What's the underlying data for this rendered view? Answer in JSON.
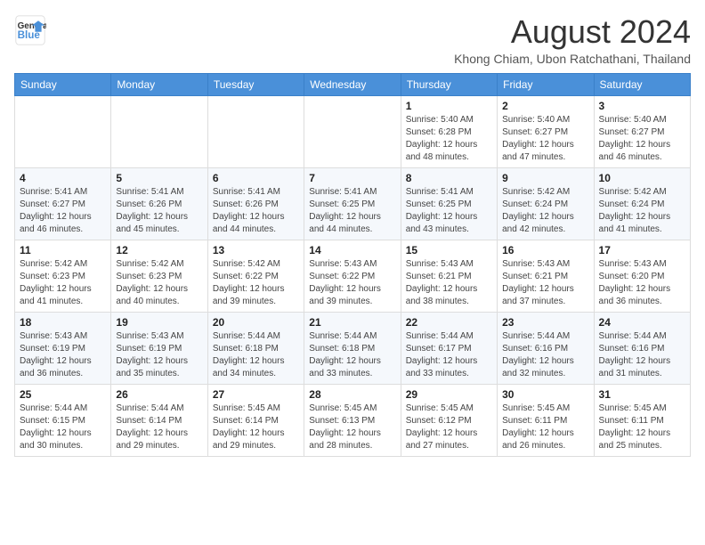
{
  "header": {
    "logo_line1": "General",
    "logo_line2": "Blue",
    "title": "August 2024",
    "subtitle": "Khong Chiam, Ubon Ratchathani, Thailand"
  },
  "days_of_week": [
    "Sunday",
    "Monday",
    "Tuesday",
    "Wednesday",
    "Thursday",
    "Friday",
    "Saturday"
  ],
  "weeks": [
    [
      {
        "day": "",
        "info": ""
      },
      {
        "day": "",
        "info": ""
      },
      {
        "day": "",
        "info": ""
      },
      {
        "day": "",
        "info": ""
      },
      {
        "day": "1",
        "info": "Sunrise: 5:40 AM\nSunset: 6:28 PM\nDaylight: 12 hours\nand 48 minutes."
      },
      {
        "day": "2",
        "info": "Sunrise: 5:40 AM\nSunset: 6:27 PM\nDaylight: 12 hours\nand 47 minutes."
      },
      {
        "day": "3",
        "info": "Sunrise: 5:40 AM\nSunset: 6:27 PM\nDaylight: 12 hours\nand 46 minutes."
      }
    ],
    [
      {
        "day": "4",
        "info": "Sunrise: 5:41 AM\nSunset: 6:27 PM\nDaylight: 12 hours\nand 46 minutes."
      },
      {
        "day": "5",
        "info": "Sunrise: 5:41 AM\nSunset: 6:26 PM\nDaylight: 12 hours\nand 45 minutes."
      },
      {
        "day": "6",
        "info": "Sunrise: 5:41 AM\nSunset: 6:26 PM\nDaylight: 12 hours\nand 44 minutes."
      },
      {
        "day": "7",
        "info": "Sunrise: 5:41 AM\nSunset: 6:25 PM\nDaylight: 12 hours\nand 44 minutes."
      },
      {
        "day": "8",
        "info": "Sunrise: 5:41 AM\nSunset: 6:25 PM\nDaylight: 12 hours\nand 43 minutes."
      },
      {
        "day": "9",
        "info": "Sunrise: 5:42 AM\nSunset: 6:24 PM\nDaylight: 12 hours\nand 42 minutes."
      },
      {
        "day": "10",
        "info": "Sunrise: 5:42 AM\nSunset: 6:24 PM\nDaylight: 12 hours\nand 41 minutes."
      }
    ],
    [
      {
        "day": "11",
        "info": "Sunrise: 5:42 AM\nSunset: 6:23 PM\nDaylight: 12 hours\nand 41 minutes."
      },
      {
        "day": "12",
        "info": "Sunrise: 5:42 AM\nSunset: 6:23 PM\nDaylight: 12 hours\nand 40 minutes."
      },
      {
        "day": "13",
        "info": "Sunrise: 5:42 AM\nSunset: 6:22 PM\nDaylight: 12 hours\nand 39 minutes."
      },
      {
        "day": "14",
        "info": "Sunrise: 5:43 AM\nSunset: 6:22 PM\nDaylight: 12 hours\nand 39 minutes."
      },
      {
        "day": "15",
        "info": "Sunrise: 5:43 AM\nSunset: 6:21 PM\nDaylight: 12 hours\nand 38 minutes."
      },
      {
        "day": "16",
        "info": "Sunrise: 5:43 AM\nSunset: 6:21 PM\nDaylight: 12 hours\nand 37 minutes."
      },
      {
        "day": "17",
        "info": "Sunrise: 5:43 AM\nSunset: 6:20 PM\nDaylight: 12 hours\nand 36 minutes."
      }
    ],
    [
      {
        "day": "18",
        "info": "Sunrise: 5:43 AM\nSunset: 6:19 PM\nDaylight: 12 hours\nand 36 minutes."
      },
      {
        "day": "19",
        "info": "Sunrise: 5:43 AM\nSunset: 6:19 PM\nDaylight: 12 hours\nand 35 minutes."
      },
      {
        "day": "20",
        "info": "Sunrise: 5:44 AM\nSunset: 6:18 PM\nDaylight: 12 hours\nand 34 minutes."
      },
      {
        "day": "21",
        "info": "Sunrise: 5:44 AM\nSunset: 6:18 PM\nDaylight: 12 hours\nand 33 minutes."
      },
      {
        "day": "22",
        "info": "Sunrise: 5:44 AM\nSunset: 6:17 PM\nDaylight: 12 hours\nand 33 minutes."
      },
      {
        "day": "23",
        "info": "Sunrise: 5:44 AM\nSunset: 6:16 PM\nDaylight: 12 hours\nand 32 minutes."
      },
      {
        "day": "24",
        "info": "Sunrise: 5:44 AM\nSunset: 6:16 PM\nDaylight: 12 hours\nand 31 minutes."
      }
    ],
    [
      {
        "day": "25",
        "info": "Sunrise: 5:44 AM\nSunset: 6:15 PM\nDaylight: 12 hours\nand 30 minutes."
      },
      {
        "day": "26",
        "info": "Sunrise: 5:44 AM\nSunset: 6:14 PM\nDaylight: 12 hours\nand 29 minutes."
      },
      {
        "day": "27",
        "info": "Sunrise: 5:45 AM\nSunset: 6:14 PM\nDaylight: 12 hours\nand 29 minutes."
      },
      {
        "day": "28",
        "info": "Sunrise: 5:45 AM\nSunset: 6:13 PM\nDaylight: 12 hours\nand 28 minutes."
      },
      {
        "day": "29",
        "info": "Sunrise: 5:45 AM\nSunset: 6:12 PM\nDaylight: 12 hours\nand 27 minutes."
      },
      {
        "day": "30",
        "info": "Sunrise: 5:45 AM\nSunset: 6:11 PM\nDaylight: 12 hours\nand 26 minutes."
      },
      {
        "day": "31",
        "info": "Sunrise: 5:45 AM\nSunset: 6:11 PM\nDaylight: 12 hours\nand 25 minutes."
      }
    ]
  ]
}
